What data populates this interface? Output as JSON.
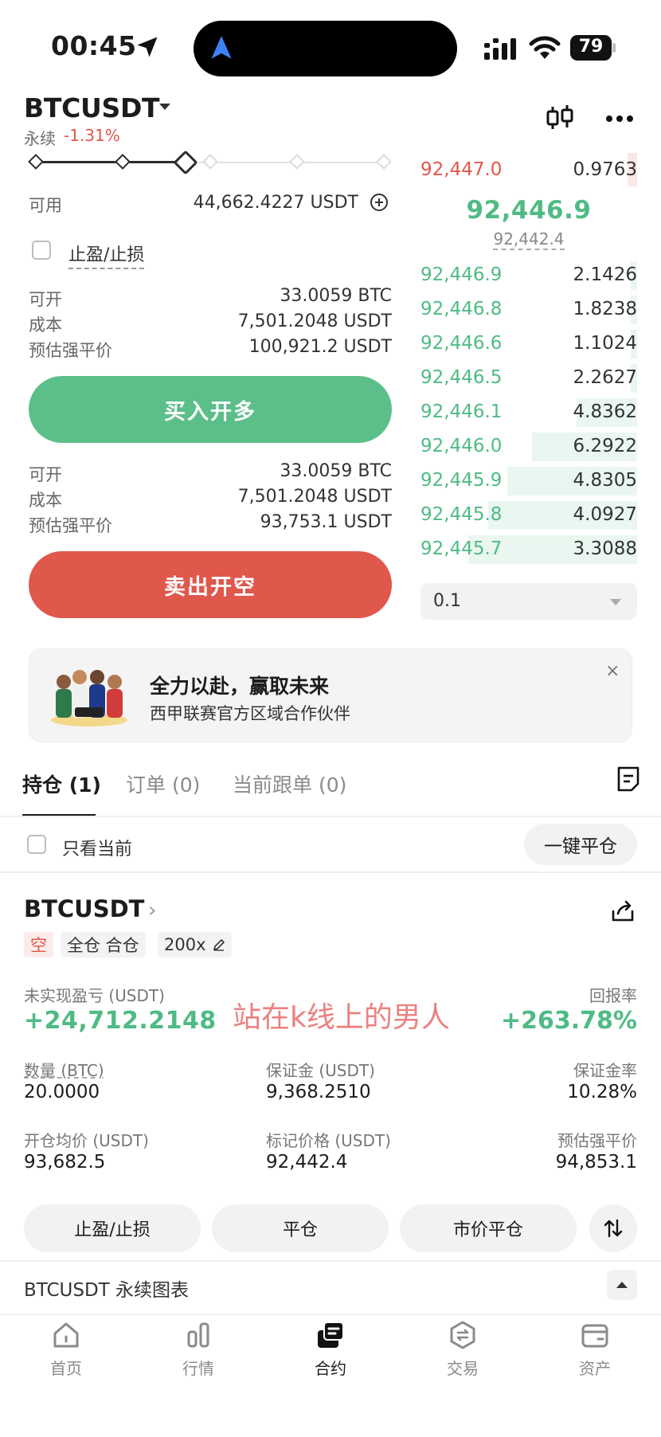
{
  "status_bar": {
    "time": "00:45",
    "battery": "79"
  },
  "header": {
    "symbol": "BTCUSDT",
    "contract_type": "永续",
    "change": "-1.31%"
  },
  "leverage_slider": {
    "value_fraction": 0.4
  },
  "form": {
    "available_label": "可用",
    "available_value": "44,662.4227 USDT",
    "tpsl_label": "止盈/止损",
    "long": {
      "rows": [
        {
          "label": "可开",
          "value": "33.0059 BTC"
        },
        {
          "label": "成本",
          "value": "7,501.2048 USDT"
        },
        {
          "label": "预估强平价",
          "value": "100,921.2 USDT"
        }
      ],
      "button": "买入开多"
    },
    "short": {
      "rows": [
        {
          "label": "可开",
          "value": "33.0059 BTC"
        },
        {
          "label": "成本",
          "value": "7,501.2048 USDT"
        },
        {
          "label": "预估强平价",
          "value": "93,753.1 USDT"
        }
      ],
      "button": "卖出开空"
    }
  },
  "order_book": {
    "asks": [
      {
        "price": "92,447.0",
        "qty": "0.9763"
      }
    ],
    "last_price": "92,446.9",
    "mark_price": "92,442.4",
    "bids": [
      {
        "price": "92,446.9",
        "qty": "2.1426",
        "depth": 0.04
      },
      {
        "price": "92,446.8",
        "qty": "1.8238",
        "depth": 0.04
      },
      {
        "price": "92,446.6",
        "qty": "1.1024",
        "depth": 0.04
      },
      {
        "price": "92,446.5",
        "qty": "2.2627",
        "depth": 0.04
      },
      {
        "price": "92,446.1",
        "qty": "4.8362",
        "depth": 0.36
      },
      {
        "price": "92,446.0",
        "qty": "6.2922",
        "depth": 0.62
      },
      {
        "price": "92,445.9",
        "qty": "4.8305",
        "depth": 0.77
      },
      {
        "price": "92,445.8",
        "qty": "4.0927",
        "depth": 0.88
      },
      {
        "price": "92,445.7",
        "qty": "3.3088",
        "depth": 1.0
      }
    ],
    "precision": "0.1"
  },
  "banner": {
    "title": "全力以赴，赢取未来",
    "subtitle": "西甲联赛官方区域合作伙伴",
    "close": "×"
  },
  "tabs": [
    {
      "label": "持仓 (1)",
      "active": true
    },
    {
      "label": "订单 (0)",
      "active": false
    },
    {
      "label": "当前跟单 (0)",
      "active": false
    }
  ],
  "filter": {
    "only_current": "只看当前",
    "close_all": "一键平仓"
  },
  "position": {
    "symbol": "BTCUSDT",
    "tags": {
      "side": "空",
      "margin_mode": "全仓 合仓",
      "leverage": "200x"
    },
    "unrealized_pnl_label": "未实现盈亏 (USDT)",
    "unrealized_pnl": "+24,712.2148",
    "roe_label": "回报率",
    "roe": "+263.78%",
    "watermark": "站在k线上的男人",
    "fields": [
      {
        "label": "数量 (BTC)",
        "value": "20.0000"
      },
      {
        "label": "保证金 (USDT)",
        "value": "9,368.2510"
      },
      {
        "label": "保证金率",
        "value": "10.28%"
      },
      {
        "label": "开仓均价 (USDT)",
        "value": "93,682.5"
      },
      {
        "label": "标记价格 (USDT)",
        "value": "92,442.4"
      },
      {
        "label": "预估强平价",
        "value": "94,853.1"
      }
    ],
    "actions": {
      "tpsl": "止盈/止损",
      "close": "平仓",
      "market_close": "市价平仓"
    }
  },
  "chart_section": {
    "label": "BTCUSDT 永续图表"
  },
  "bottom_nav": [
    {
      "label": "首页",
      "icon": "home-icon",
      "active": false
    },
    {
      "label": "行情",
      "icon": "market-icon",
      "active": false
    },
    {
      "label": "合约",
      "icon": "futures-icon",
      "active": true
    },
    {
      "label": "交易",
      "icon": "trade-icon",
      "active": false
    },
    {
      "label": "资产",
      "icon": "wallet-icon",
      "active": false
    }
  ],
  "colors": {
    "green": "#4fbb84",
    "red": "#e0574c",
    "buy_button": "#5cbf8a",
    "sell_button": "#e0574c"
  }
}
